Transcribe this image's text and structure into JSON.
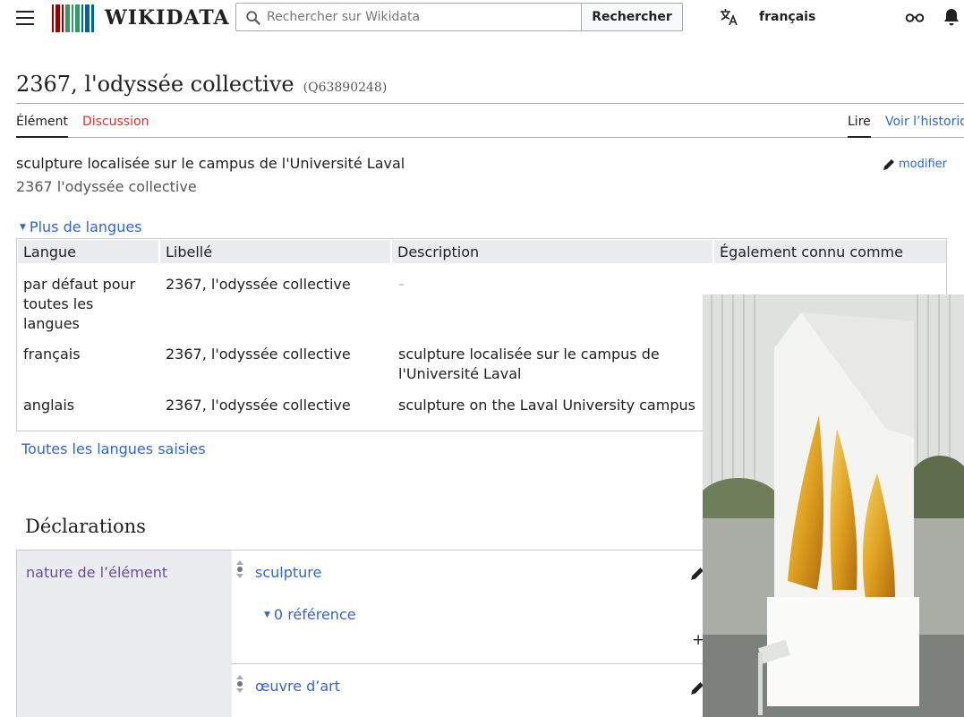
{
  "header": {
    "logo_text": "WIKIDATA",
    "search_placeholder": "Rechercher sur Wikidata",
    "search_button": "Rechercher",
    "language": "français"
  },
  "page": {
    "title": "2367, l'odyssée collective",
    "qid": "(Q63890248)"
  },
  "tabs": {
    "item": "Élément",
    "discussion": "Discussion",
    "read": "Lire",
    "history": "Voir l’historiq"
  },
  "summary": {
    "description": "sculpture localisée sur le campus de l'Université Laval",
    "alias": "2367 l'odyssée collective",
    "edit_label": "modifier"
  },
  "languages": {
    "toggle_label": "Plus de langues",
    "headers": [
      "Langue",
      "Libellé",
      "Description",
      "Également connu comme"
    ],
    "rows": [
      {
        "lang": "par défaut pour toutes les langues",
        "label": "2367, l'odyssée collective",
        "desc": "–",
        "aliases": ""
      },
      {
        "lang": "français",
        "label": "2367, l'odyssée collective",
        "desc": "sculpture localisée sur le campus de l'Université Laval",
        "aliases": ""
      },
      {
        "lang": "anglais",
        "label": "2367, l'odyssée collective",
        "desc": "sculpture on the Laval University campus",
        "aliases": ""
      }
    ],
    "all_link": "Toutes les langues saisies"
  },
  "declarations": {
    "heading": "Déclarations",
    "property": "nature de l’élément",
    "values": [
      {
        "label": "sculpture",
        "references": "0 référence"
      },
      {
        "label": "œuvre d’art"
      }
    ]
  },
  "colors": {
    "link": "#3366cc",
    "property": "#6b4ba1",
    "table_header": "#eaecf0",
    "discussion": "#d73333"
  }
}
